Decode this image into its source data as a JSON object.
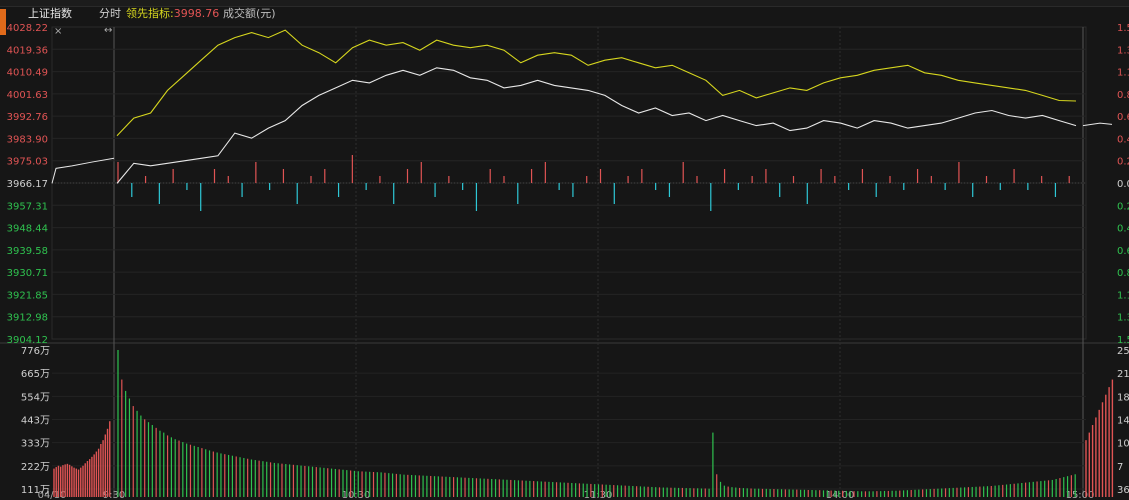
{
  "header": {
    "index_name": "上证指数",
    "mode": "分时",
    "leading_label": "领先指标:",
    "leading_value": "3998.76",
    "volume_label": "成交额(元)",
    "close_symbol": "×",
    "resize_symbol": "↔"
  },
  "colors": {
    "background": "#161616",
    "price_line": "#e8e8e8",
    "leading_line": "#d6d61e",
    "up": "#e05454",
    "down": "#2ec8d6",
    "green_bar": "#2fc24f",
    "axis_red": "#e05454",
    "axis_green": "#2fc24f",
    "grid": "#3a3a3a"
  },
  "chart_data": {
    "type": "line",
    "y_left_ticks": [
      "4028.22",
      "4019.36",
      "4010.49",
      "4001.63",
      "3992.76",
      "3983.90",
      "3975.03",
      "3966.17",
      "3957.31",
      "3948.44",
      "3939.58",
      "3930.71",
      "3921.85",
      "3912.98",
      "3904.12"
    ],
    "y_right_ticks": [
      "1.5",
      "1.3",
      "1.1",
      "0.8",
      "0.6",
      "0.4",
      "0.2",
      "0.0",
      "0.2",
      "0.4",
      "0.6",
      "0.8",
      "1.1",
      "1.3",
      "1.5"
    ],
    "x_ticks": [
      "04/10",
      "9:30",
      "10:30",
      "11:30",
      "14:00",
      "15:00"
    ],
    "ylim": [
      3904.12,
      4028.22
    ],
    "series": [
      {
        "values": [
          3966,
          3974,
          3973,
          3974,
          3975,
          3976,
          3977,
          3986,
          3984,
          3988,
          3991,
          3997,
          4001,
          4004,
          4007,
          4006,
          4009,
          4011,
          4009,
          4012,
          4011,
          4008,
          4007,
          4004,
          4005,
          4007,
          4005,
          4004,
          4003,
          4001,
          3997,
          3994,
          3996,
          3993,
          3994,
          3991,
          3993,
          3991,
          3989,
          3990,
          3987,
          3988,
          3991,
          3990,
          3988,
          3991,
          3990,
          3988,
          3989,
          3990,
          3992,
          3994,
          3995,
          3993,
          3992,
          3993,
          3991,
          3989
        ]
      },
      {
        "values": [
          3985,
          3992,
          3994,
          4003,
          4009,
          4015,
          4021,
          4024,
          4026,
          4024,
          4027,
          4021,
          4018,
          4014,
          4020,
          4023,
          4021,
          4022,
          4019,
          4023,
          4021,
          4020,
          4021,
          4019,
          4014,
          4017,
          4018,
          4017,
          4013,
          4015,
          4016,
          4014,
          4012,
          4013,
          4010,
          4007,
          4001,
          4003,
          4000,
          4002,
          4004,
          4003,
          4006,
          4008,
          4009,
          4011,
          4012,
          4013,
          4010,
          4009,
          4007,
          4006,
          4005,
          4004,
          4003,
          4001,
          3999,
          3998.8
        ]
      }
    ],
    "change_bars": [
      3,
      -2,
      1,
      -3,
      2,
      -1,
      -4,
      2,
      1,
      -2,
      3,
      -1,
      2,
      -3,
      1,
      2,
      -2,
      4,
      -1,
      1,
      -3,
      2,
      3,
      -2,
      1,
      -1,
      -4,
      2,
      1,
      -3,
      2,
      3,
      -1,
      -2,
      1,
      2,
      -3,
      1,
      2,
      -1,
      -2,
      3,
      1,
      -4,
      2,
      -1,
      1,
      2,
      -2,
      1,
      -3,
      2,
      1,
      -1,
      2,
      -2,
      1,
      -1,
      2,
      1,
      -1,
      3,
      -2,
      1,
      -1,
      2,
      -1,
      1,
      -2,
      1
    ],
    "volume": {
      "y_ticks": [
        "776万",
        "665万",
        "554万",
        "443万",
        "333万",
        "222万",
        "111万"
      ],
      "y_right_ticks": [
        "25",
        "21",
        "18",
        "14",
        "10",
        "7",
        "36"
      ],
      "ylim": [
        0,
        776
      ],
      "pre_open": [
        150,
        158,
        165,
        160,
        168,
        172,
        175,
        170,
        162,
        155,
        150,
        145,
        155,
        165,
        178,
        190,
        200,
        212,
        225,
        240,
        255,
        280,
        300,
        330,
        360,
        400
      ],
      "session": [
        776,
        620,
        560,
        520,
        480,
        455,
        430,
        410,
        395,
        380,
        365,
        350,
        340,
        325,
        315,
        305,
        298,
        290,
        282,
        276,
        270,
        264,
        258,
        252,
        246,
        240,
        235,
        230,
        226,
        222,
        218,
        214,
        210,
        206,
        202,
        198,
        195,
        192,
        189,
        186,
        183,
        180,
        178,
        176,
        174,
        172,
        170,
        168,
        166,
        164,
        162,
        160,
        158,
        156,
        154,
        152,
        150,
        148,
        146,
        144,
        142,
        140,
        138,
        136,
        135,
        134,
        133,
        132,
        131,
        130,
        128,
        126,
        124,
        122,
        120,
        118,
        117,
        116,
        115,
        114,
        113,
        112,
        111,
        110,
        109,
        108,
        107,
        106,
        105,
        104,
        103,
        102,
        101,
        100,
        99,
        98,
        97,
        96,
        95,
        94,
        93,
        92,
        91,
        90,
        89,
        88,
        87,
        86,
        85,
        84,
        83,
        82,
        81,
        80,
        79,
        78,
        77,
        76,
        75,
        74,
        73,
        72,
        71,
        70,
        69,
        68,
        67,
        66,
        65,
        64,
        63,
        62,
        61,
        60,
        59,
        58,
        57,
        56,
        55,
        54,
        53,
        52,
        51,
        50,
        50,
        49,
        49,
        48,
        48,
        47,
        47,
        46,
        46,
        45,
        45,
        44,
        340,
        120,
        80,
        60,
        55,
        52,
        50,
        48,
        47,
        46,
        45,
        44,
        44,
        43,
        43,
        42,
        42,
        41,
        41,
        40,
        40,
        39,
        39,
        38,
        38,
        37,
        37,
        36,
        36,
        35,
        35,
        34,
        34,
        33,
        33,
        32,
        32,
        31,
        31,
        30,
        30,
        30,
        30,
        31,
        31,
        32,
        32,
        33,
        33,
        34,
        35,
        36,
        37,
        38,
        39,
        40,
        41,
        42,
        43,
        44,
        45,
        46,
        47,
        48,
        49,
        50,
        51,
        52,
        53,
        54,
        55,
        56,
        57,
        58,
        60,
        62,
        64,
        66,
        68,
        70,
        72,
        74,
        76,
        78,
        80,
        82,
        84,
        86,
        88,
        90,
        95,
        100,
        105,
        110,
        115,
        120
      ],
      "post": [
        300,
        340,
        380,
        420,
        460,
        500,
        540,
        580,
        620
      ]
    }
  }
}
